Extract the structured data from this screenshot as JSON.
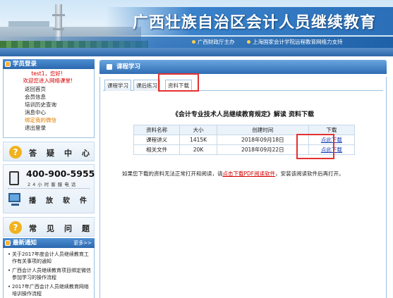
{
  "header": {
    "title": "广西壮族自治区会计人员继续教育",
    "sponsor": "广西财政厅主办",
    "support": "上海国家会计学院远程教育网络力支持"
  },
  "sidebar": {
    "login_title": "学员登录",
    "greeting": "test1，您好!",
    "welcome": "欢迎您进入网络课堂!",
    "menu": [
      "返回首页",
      "会员信息",
      "培训历史查询",
      "消息中心",
      "绑定我的微信",
      "退出登录"
    ],
    "faq_label": "答疑中心",
    "phone": "400-900-5955",
    "phone_note": "24小时客服电话",
    "software_label": "播放软件",
    "common_label": "常见问题",
    "news_title": "最新通知",
    "news_more": "更多>>",
    "news": [
      "关于2017年度会计人员继续教育工作有关事项的通知",
      "广西会计人员继续教育项目绑定微信参加学习的操作流程",
      "2017年广西会计人员继续教育网络培训操作流程"
    ]
  },
  "main": {
    "panel_title": "课程学习",
    "tabs": [
      "课程学习",
      "课后练习",
      "资料下载"
    ],
    "doc_title": "《会计专业技术人员继续教育规定》解读  资料下载",
    "table": {
      "headers": [
        "资料名称",
        "大小",
        "创建时间",
        "下载"
      ],
      "rows": [
        {
          "name": "课程讲义",
          "size": "1415K",
          "date": "2018年09月18日",
          "link": "点此下载"
        },
        {
          "name": "相关文件",
          "size": "20K",
          "date": "2018年09月22日",
          "link": "点此下载"
        }
      ]
    },
    "note_prefix": "如果您下载的资料无法正常打开和阅读，请",
    "note_link": "点击下载PDF阅读软件",
    "note_suffix": "，安装该阅读软件后再打开。"
  },
  "colors": {
    "accent": "#2f6db3",
    "highlight": "#e53030",
    "link": "#1a40b8"
  }
}
